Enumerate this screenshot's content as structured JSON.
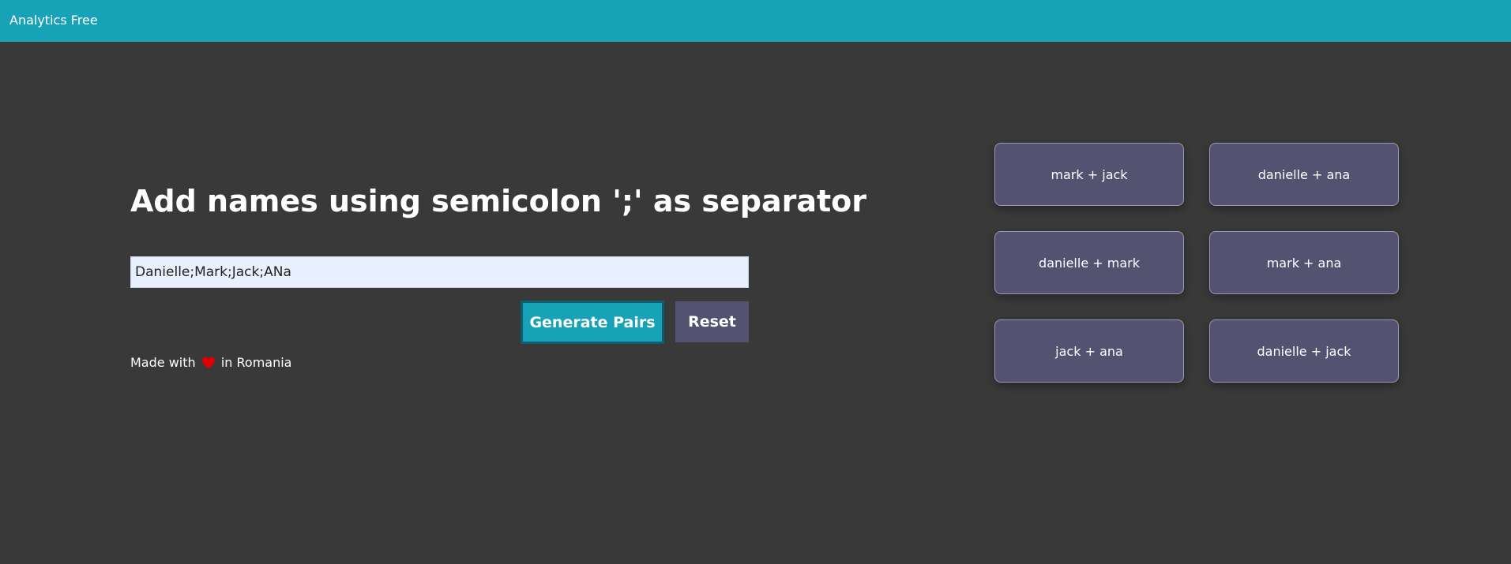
{
  "header": {
    "brand": "Analytics Free",
    "background_color": "#17a2b8"
  },
  "main": {
    "heading": "Add names using semicolon ';' as separator",
    "names_input": {
      "value": "Danielle;Mark;Jack;ANa",
      "placeholder": ""
    },
    "generate_button_label": "Generate Pairs",
    "reset_button_label": "Reset",
    "footer": {
      "prefix": "Made with",
      "icon": "heart-icon",
      "suffix": "in Romania"
    }
  },
  "pairs": [
    {
      "label": "mark + jack"
    },
    {
      "label": "danielle + ana"
    },
    {
      "label": "danielle + mark"
    },
    {
      "label": "mark + ana"
    },
    {
      "label": "jack + ana"
    },
    {
      "label": "danielle + jack"
    }
  ],
  "colors": {
    "page_background": "#393939",
    "accent": "#17a2b8",
    "card_background": "#535371",
    "heart": "#e00000"
  }
}
